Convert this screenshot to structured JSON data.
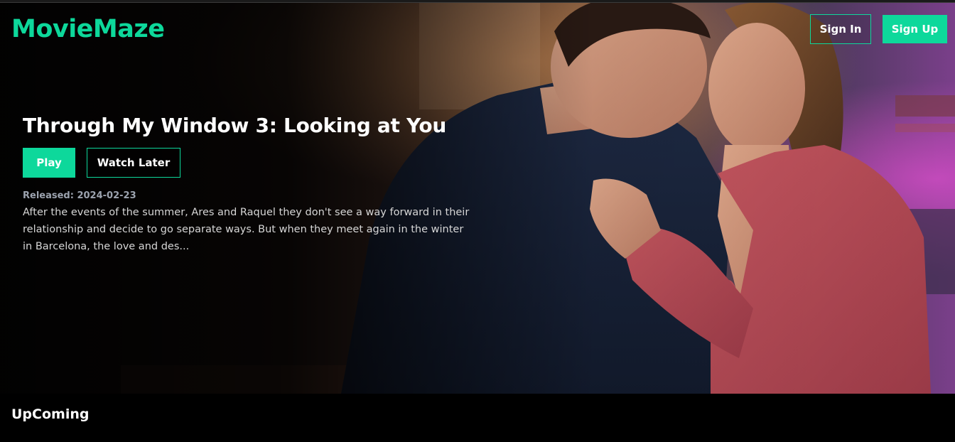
{
  "app": {
    "brand": "MovieMaze"
  },
  "nav": {
    "sign_in": "Sign In",
    "sign_up": "Sign Up"
  },
  "hero": {
    "title": "Through My Window 3: Looking at You",
    "play_label": "Play",
    "watch_later_label": "Watch Later",
    "released": "Released: 2024-02-23",
    "overview": "After the events of the summer, Ares and Raquel they don't see a way forward in their relationship and decide to go separate ways. But when they meet again in the winter in Barcelona, the love and des..."
  },
  "sections": {
    "upcoming_title": "UpComing"
  },
  "colors": {
    "accent": "#0dd89b",
    "background": "#000000",
    "text": "#ffffff",
    "muted": "#9ca3af"
  }
}
